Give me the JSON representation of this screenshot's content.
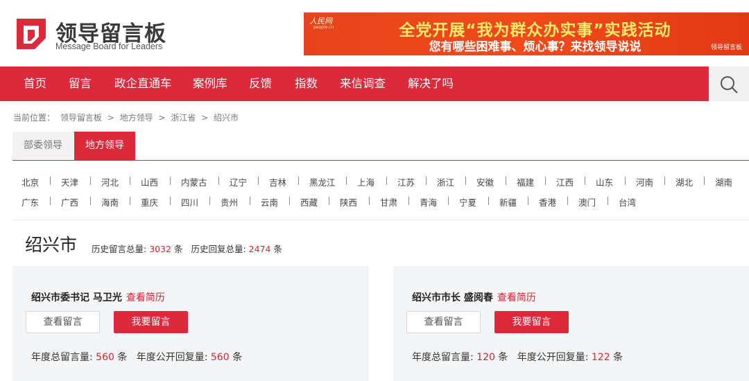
{
  "logo": {
    "title": "领导留言板",
    "subtitle": "Message Board for Leaders",
    "brand_color": "#da2a3c"
  },
  "banner": {
    "site_logo": "人民网",
    "site_logo_sub": "people.cn",
    "line1": "全党开展“我为群众办实事”实践活动",
    "line2": "您有哪些困难事、烦心事？来找领导说说",
    "mini_logo": "领导留言板"
  },
  "nav": {
    "items": [
      "首页",
      "留言",
      "政企直通车",
      "案例库",
      "反馈",
      "指数",
      "来信调查",
      "解决了吗"
    ],
    "search_icon": "search-icon"
  },
  "breadcrumb": {
    "prefix": "当前位置：",
    "items": [
      "领导留言板",
      "地方领导",
      "浙江省",
      "绍兴市"
    ],
    "separator": ">"
  },
  "tabs": {
    "items": [
      "部委领导",
      "地方领导"
    ],
    "active_index": 1
  },
  "regions": {
    "row1": [
      "北京",
      "天津",
      "河北",
      "山西",
      "内蒙古",
      "辽宁",
      "吉林",
      "黑龙江",
      "上海",
      "江苏",
      "浙江",
      "安徽",
      "福建",
      "江西",
      "山东",
      "河南",
      "湖北",
      "湖南"
    ],
    "row2": [
      "广东",
      "广西",
      "海南",
      "重庆",
      "四川",
      "贵州",
      "云南",
      "西藏",
      "陕西",
      "甘肃",
      "青海",
      "宁夏",
      "新疆",
      "香港",
      "澳门",
      "台湾"
    ]
  },
  "city": {
    "name": "绍兴市",
    "total_label": "历史留言总量:",
    "total_value": "3032",
    "reply_label": "历史回复总量:",
    "reply_value": "2474",
    "unit": "条"
  },
  "leaders": [
    {
      "title": "绍兴市委书记 马卫光",
      "resume_link": "查看简历",
      "view_button": "查看留言",
      "leave_button": "我要留言",
      "year_total_label": "年度总留言量:",
      "year_total_value": "560",
      "year_reply_label": "年度公开回复量:",
      "year_reply_value": "560",
      "unit": "条"
    },
    {
      "title": "绍兴市市长 盛阅春",
      "resume_link": "查看简历",
      "view_button": "查看留言",
      "leave_button": "我要留言",
      "year_total_label": "年度总留言量:",
      "year_total_value": "120",
      "year_reply_label": "年度公开回复量:",
      "year_reply_value": "122",
      "unit": "条"
    }
  ],
  "colors": {
    "accent": "#da2a3c",
    "highlight_number": "#d9232f",
    "card_bg": "#f4f5f7",
    "banner_bg": "#f04a1b"
  }
}
